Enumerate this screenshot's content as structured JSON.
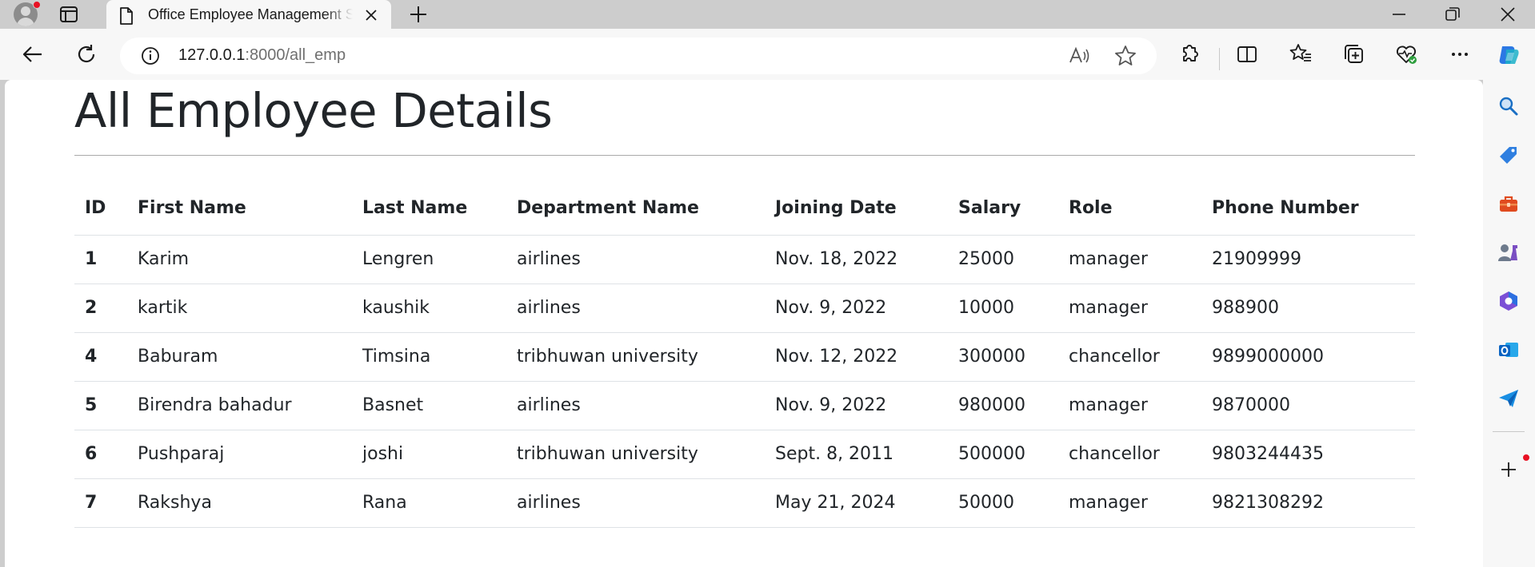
{
  "browser": {
    "tab_title": "Office Employee Management System",
    "url_host": "127.0.0.1",
    "url_rest": ":8000/all_emp"
  },
  "page": {
    "title": "All Employee Details"
  },
  "table": {
    "headers": [
      "ID",
      "First Name",
      "Last Name",
      "Department Name",
      "Joining Date",
      "Salary",
      "Role",
      "Phone Number"
    ],
    "rows": [
      [
        "1",
        "Karim",
        "Lengren",
        "airlines",
        "Nov. 18, 2022",
        "25000",
        "manager",
        "21909999"
      ],
      [
        "2",
        "kartik",
        "kaushik",
        "airlines",
        "Nov. 9, 2022",
        "10000",
        "manager",
        "988900"
      ],
      [
        "4",
        "Baburam",
        "Timsina",
        "tribhuwan university",
        "Nov. 12, 2022",
        "300000",
        "chancellor",
        "9899000000"
      ],
      [
        "5",
        "Birendra bahadur",
        "Basnet",
        "airlines",
        "Nov. 9, 2022",
        "980000",
        "manager",
        "9870000"
      ],
      [
        "6",
        "Pushparaj",
        "joshi",
        "tribhuwan university",
        "Sept. 8, 2011",
        "500000",
        "chancellor",
        "9803244435"
      ],
      [
        "7",
        "Rakshya",
        "Rana",
        "airlines",
        "May 21, 2024",
        "50000",
        "manager",
        "9821308292"
      ]
    ]
  },
  "icons": {
    "profile": "profile-avatar-icon",
    "tab_actions": "tab-actions-icon",
    "page": "page-icon",
    "close": "close-icon",
    "new_tab": "plus-icon",
    "back": "back-arrow-icon",
    "refresh": "refresh-icon",
    "info": "info-icon",
    "read_aloud": "read-aloud-icon",
    "favorite": "star-icon",
    "extensions": "puzzle-icon",
    "split": "split-screen-icon",
    "favorites": "favorites-icon",
    "collections": "collections-icon",
    "health": "browser-essentials-icon",
    "more": "more-icon",
    "copilot": "copilot-icon",
    "search": "search-icon",
    "shopping": "tag-icon",
    "tools": "toolbox-icon",
    "games": "games-icon",
    "office": "microsoft365-icon",
    "outlook": "outlook-icon",
    "send": "send-icon",
    "add": "plus-icon"
  },
  "colors": {
    "chrome": "#cdcdcd",
    "toolbar": "#f7f7f7",
    "text": "#212529",
    "notification": "#e81123",
    "copilot_blue": "#2b78e4"
  }
}
